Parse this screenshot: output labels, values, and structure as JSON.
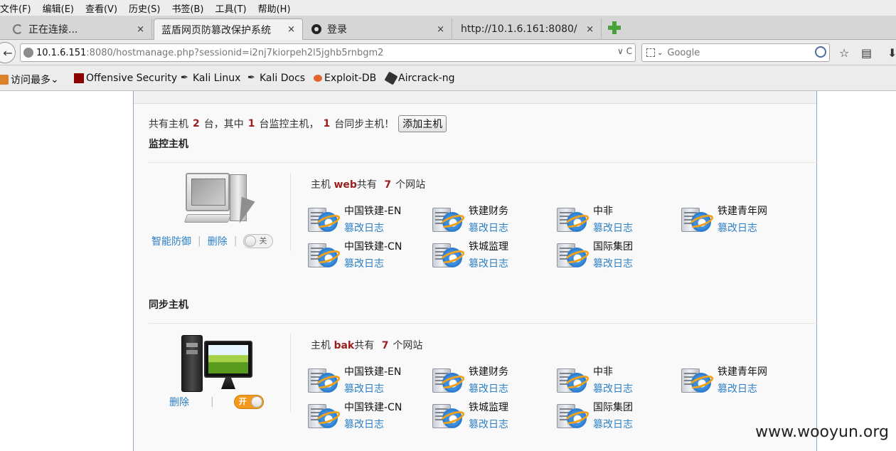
{
  "menu": [
    "文件(F)",
    "编辑(E)",
    "查看(V)",
    "历史(S)",
    "书签(B)",
    "工具(T)",
    "帮助(H)"
  ],
  "tabs": [
    {
      "title": "正在连接...",
      "close": "×",
      "icon": "loading-spinner-icon"
    },
    {
      "title": "蓝盾网页防篡改保护系统",
      "close": "×",
      "icon": "none"
    },
    {
      "title": "登录",
      "close": "×",
      "icon": "webcam-icon"
    },
    {
      "title": "http://10.1.6.161:8080/",
      "close": "×",
      "icon": "none"
    }
  ],
  "nav": {
    "url_host": "10.1.6.151",
    "url_rest": ":8080/hostmanage.php?sessionid=i2nj7kiorpeh2l5jghb5rnbgm2",
    "url_tools": "∨ C",
    "search_placeholder": "Google"
  },
  "bookmarks": [
    {
      "label": "访问最多",
      "suffix": "⌄",
      "icon": "folder-icon",
      "color": "#d9822b"
    },
    {
      "label": "Offensive Security",
      "icon": "offsec-icon",
      "color": "#8b0000"
    },
    {
      "label": "Kali Linux",
      "icon": "kali-dragon-icon",
      "color": "#222222"
    },
    {
      "label": "Kali Docs",
      "icon": "kali-dragon-icon",
      "color": "#222222"
    },
    {
      "label": "Exploit-DB",
      "icon": "exploitdb-icon",
      "color": "#e0662b"
    },
    {
      "label": "Aircrack-ng",
      "icon": "aircrack-icon",
      "color": "#333333"
    }
  ],
  "summary": {
    "prefix": "共有主机",
    "total": "2",
    "mid1": "台，其中",
    "monitor_count": "1",
    "mid2": "台监控主机，",
    "sync_count": "1",
    "suffix": "台同步主机！",
    "add_button": "添加主机"
  },
  "monitor": {
    "section_title": "监控主机",
    "host_prefix": "主机",
    "host_name": "web",
    "mid": "共有",
    "site_count": "7",
    "suffix": "个网站",
    "actions": {
      "defense": "智能防御",
      "sep": "|",
      "delete": "删除",
      "sep2": "|"
    },
    "toggle": {
      "state": "off",
      "label": "关"
    },
    "sites": [
      {
        "name": "中国铁建-EN",
        "log": "篡改日志"
      },
      {
        "name": "铁建财务",
        "log": "篡改日志"
      },
      {
        "name": "中非",
        "log": "篡改日志"
      },
      {
        "name": "铁建青年网",
        "log": "篡改日志"
      },
      {
        "name": "中国铁建-CN",
        "log": "篡改日志"
      },
      {
        "name": "铁城监理",
        "log": "篡改日志"
      },
      {
        "name": "国际集团",
        "log": "篡改日志"
      }
    ]
  },
  "sync": {
    "section_title": "同步主机",
    "host_prefix": "主机",
    "host_name": "bak",
    "mid": "共有",
    "site_count": "7",
    "suffix": "个网站",
    "actions": {
      "delete": "删除",
      "sep": "|"
    },
    "toggle": {
      "state": "on",
      "label": "开"
    },
    "sites": [
      {
        "name": "中国铁建-EN",
        "log": "篡改日志"
      },
      {
        "name": "铁建财务",
        "log": "篡改日志"
      },
      {
        "name": "中非",
        "log": "篡改日志"
      },
      {
        "name": "铁建青年网",
        "log": "篡改日志"
      },
      {
        "name": "中国铁建-CN",
        "log": "篡改日志"
      },
      {
        "name": "铁城监理",
        "log": "篡改日志"
      },
      {
        "name": "国际集团",
        "log": "篡改日志"
      }
    ]
  },
  "watermark": "www.wooyun.org",
  "colors": {
    "accent_red": "#9b1e1e",
    "link_blue": "#2a7fc6",
    "toggle_on": "#f39a1c"
  }
}
